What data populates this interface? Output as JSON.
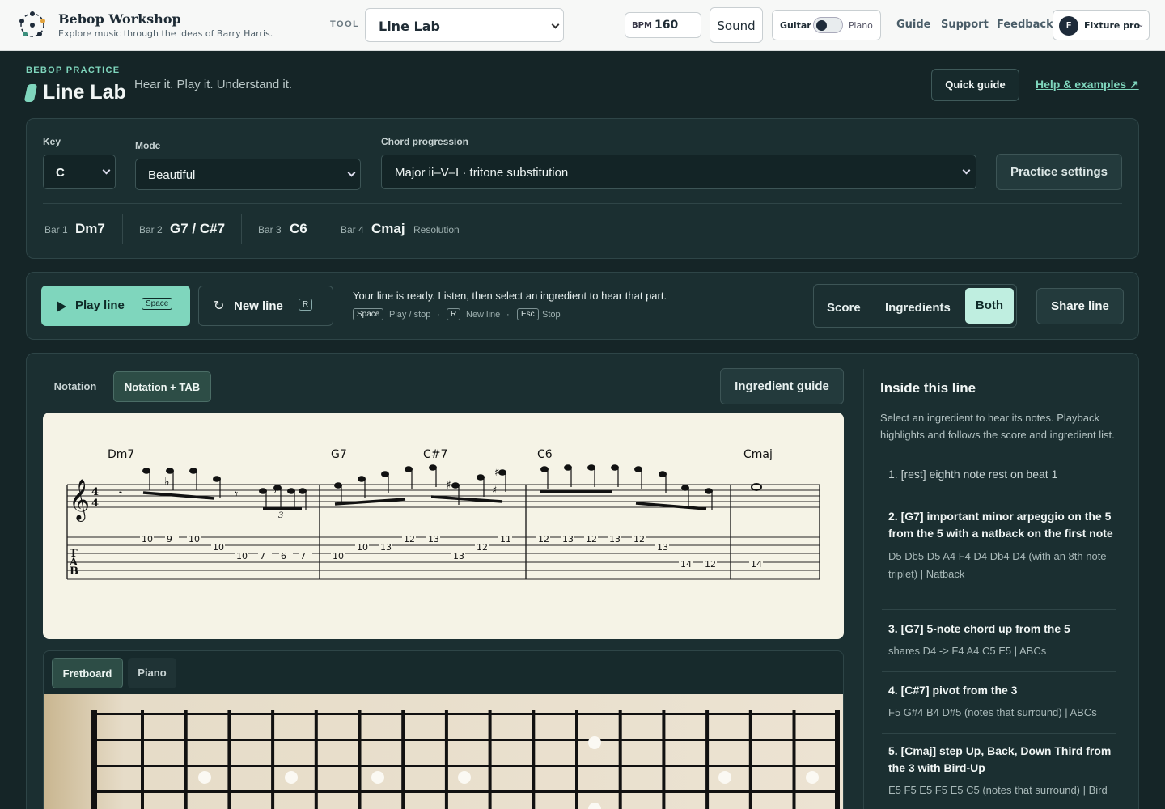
{
  "topbar": {
    "brand_title": "Bebop Workshop",
    "brand_subtitle": "Explore music through the ideas of Barry Harris.",
    "tool_label": "TOOL",
    "tool_value": "Line Lab",
    "bpm_label": "BPM",
    "bpm_value": "160",
    "sound_label": "Sound",
    "instrument_left": "Guitar",
    "instrument_right": "Piano",
    "instrument_selected": "Guitar",
    "nav": [
      "Guide",
      "Support",
      "Feedback"
    ],
    "account_initial": "F",
    "account_name": "Fixture pro",
    "account_caret": "⌄"
  },
  "header": {
    "eyebrow": "BEBOP PRACTICE",
    "title": "Line Lab",
    "tagline": "Hear it. Play it. Understand it.",
    "quick_guide": "Quick guide",
    "help_link": "Help & examples ↗"
  },
  "settings": {
    "key_label": "Key",
    "key_value": "C",
    "mode_label": "Mode",
    "mode_value": "Beautiful",
    "progression_label": "Chord progression",
    "progression_value": "Major ii–V–I · tritone substitution",
    "practice_settings": "Practice settings",
    "bars": [
      {
        "label": "Bar 1",
        "chord": "Dm7",
        "note": ""
      },
      {
        "label": "Bar 2",
        "chord": "G7 / C#7",
        "note": ""
      },
      {
        "label": "Bar 3",
        "chord": "C6",
        "note": ""
      },
      {
        "label": "Bar 4",
        "chord": "Cmaj",
        "note": "Resolution"
      }
    ]
  },
  "transport": {
    "play_label": "Play line",
    "play_key": "Space",
    "new_label": "New line",
    "new_key": "R",
    "status": "Your line is ready. Listen, then select an ingredient to hear that part.",
    "shortcuts": [
      {
        "key": "Space",
        "label": "Play / stop"
      },
      {
        "key": "R",
        "label": "New line"
      },
      {
        "key": "Esc",
        "label": "Stop"
      }
    ],
    "views": [
      "Score",
      "Ingredients",
      "Both"
    ],
    "active_view": "Both",
    "share": "Share line"
  },
  "notation": {
    "tabs": [
      "Notation",
      "Notation + TAB"
    ],
    "active_tab": "Notation + TAB",
    "ingredient_guide": "Ingredient guide",
    "chord_symbols": [
      "Dm7",
      "G7",
      "C#7",
      "C6",
      "Cmaj"
    ],
    "tab_numbers_bar1": [
      "10",
      "9",
      "10",
      "10",
      "10",
      "7",
      "6",
      "7"
    ],
    "tab_numbers_bar2": [
      "10",
      "10",
      "13",
      "12",
      "13",
      "13",
      "12",
      "11"
    ],
    "tab_numbers_bar3": [
      "12",
      "13",
      "12",
      "13",
      "12",
      "13",
      "14",
      "12"
    ],
    "tab_numbers_bar4": [
      "14"
    ],
    "triplet_mark": "3",
    "time_signature": [
      "4",
      "4"
    ]
  },
  "fretboard": {
    "tabs": [
      "Fretboard",
      "Piano"
    ],
    "active_tab": "Fretboard"
  },
  "sidebar": {
    "title": "Inside this line",
    "description": "Select an ingredient to hear its notes. Playback highlights and follows the score and ingredient list.",
    "ingredients": [
      {
        "title": "1. [rest] eighth note rest on beat 1",
        "detail": ""
      },
      {
        "title": "2. [G7] important minor arpeggio on the 5 from the 5 with a natback on the first note",
        "detail": "D5 Db5 D5 A4 F4 D4 Db4 D4 (with an 8th note triplet) | Natback"
      },
      {
        "title": "3. [G7] 5-note chord up from the 5",
        "detail": "shares D4 -> F4 A4 C5 E5 | ABCs"
      },
      {
        "title": "4. [C#7] pivot from the 3",
        "detail": "F5 G#4 B4 D#5 (notes that surround) | ABCs"
      },
      {
        "title": "5. [Cmaj] step Up, Back, Down Third from the 3 with Bird-Up",
        "detail": "E5 F5 E5 F5 E5 C5 (notes that surround) | Bird"
      }
    ]
  },
  "colors": {
    "accent": "#7fd6bd",
    "background": "#152527",
    "panel": "#1b2f31",
    "score_paper": "#f5f3e6"
  }
}
